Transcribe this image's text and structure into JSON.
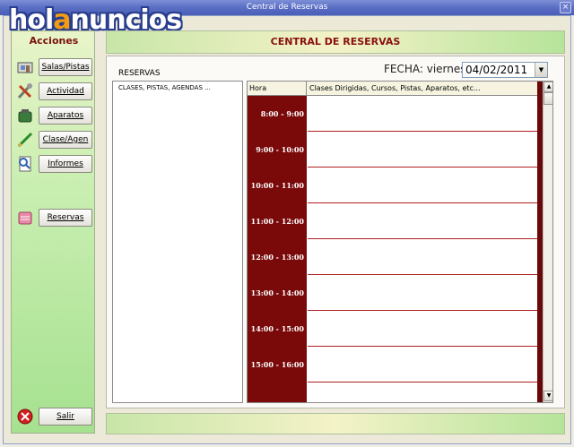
{
  "window": {
    "title": "Central de Reservas",
    "close": "×"
  },
  "logo": {
    "part1": "hol",
    "part2": "a",
    "part3": "nuncios"
  },
  "sidebar": {
    "title": "Acciones",
    "buttons": [
      {
        "label": "Salas/Pistas",
        "icon": "rooms-icon"
      },
      {
        "label": "Actividad",
        "icon": "tools-icon"
      },
      {
        "label": "Aparatos",
        "icon": "equipment-icon"
      },
      {
        "label": "Clase/Agen",
        "icon": "agenda-icon"
      },
      {
        "label": "Informes",
        "icon": "reports-icon"
      },
      {
        "label": "Reservas",
        "icon": "reservations-icon"
      },
      {
        "label": "Salir",
        "icon": "exit-icon"
      }
    ]
  },
  "banner": {
    "title": "CENTRAL DE RESERVAS"
  },
  "reservas": {
    "label": "RESERVAS",
    "fecha_label": "FECHA: viernes",
    "date": "04/02/2011",
    "list_items": [
      "CLASES, PISTAS, AGENDAS ..."
    ]
  },
  "grid": {
    "col_hora": "Hora",
    "col_clases": "Clases Dirigidas, Cursos, Pistas, Aparatos, etc...",
    "slots": [
      "8:00 - 9:00",
      "9:00 - 10:00",
      "10:00 - 11:00",
      "11:00 - 12:00",
      "12:00 - 13:00",
      "13:00 - 14:00",
      "14:00 - 15:00",
      "15:00 - 16:00"
    ]
  },
  "colors": {
    "accent": "#7a0a0a",
    "title_bar": "#5a6ec4",
    "panel_green": "#a6e190"
  }
}
